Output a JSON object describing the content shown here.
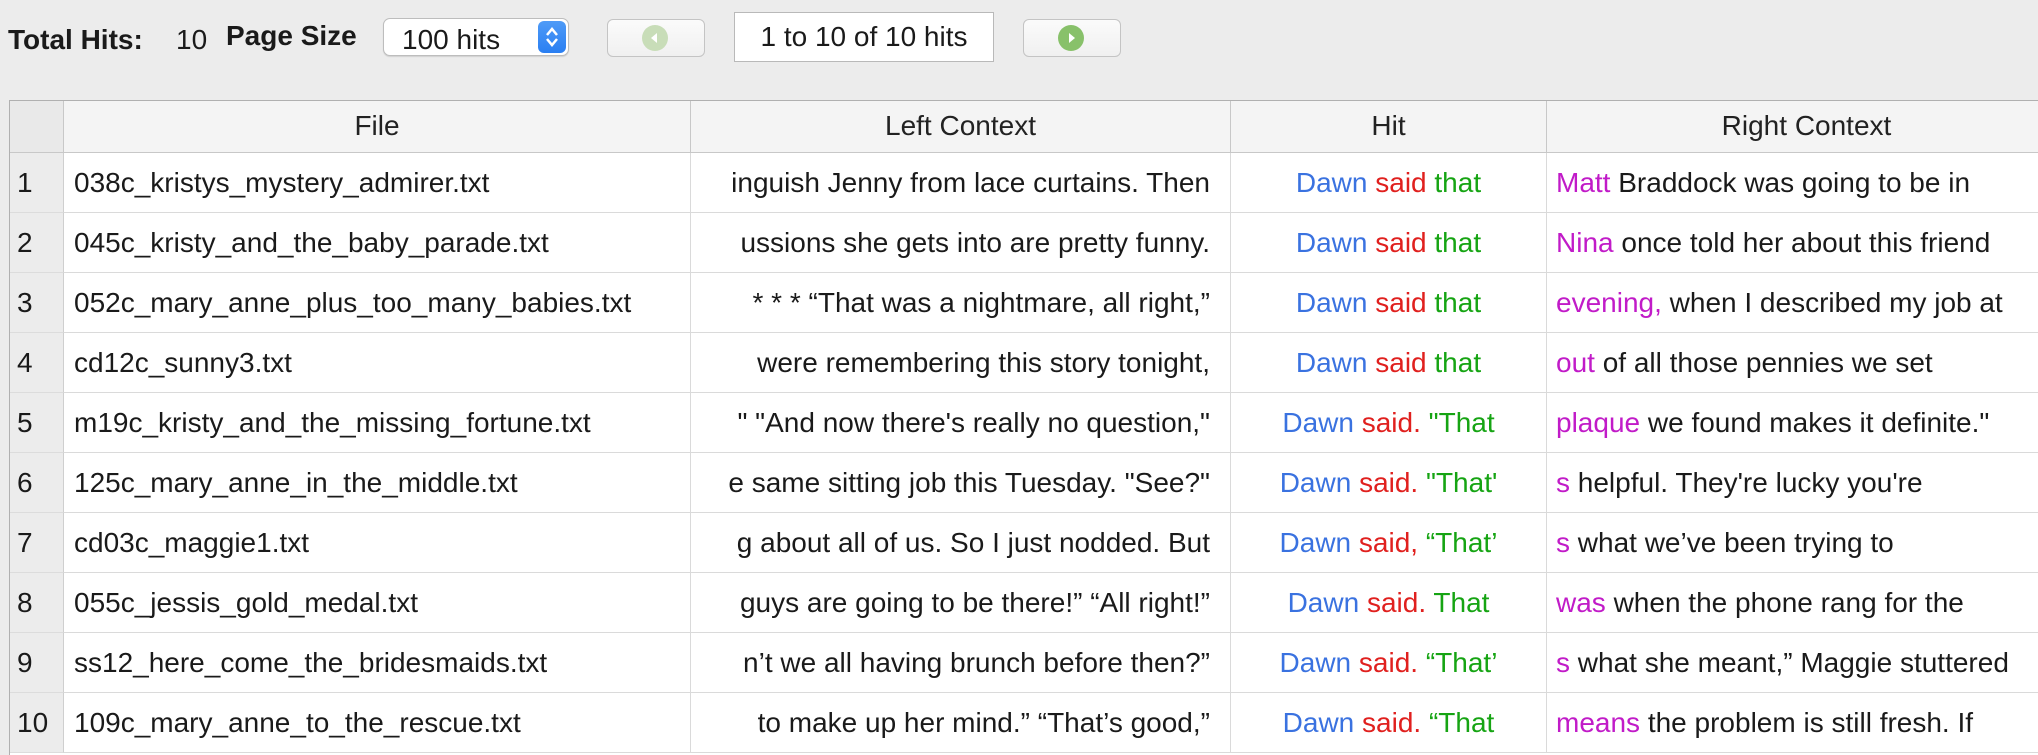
{
  "toolbar": {
    "total_hits_label": "Total Hits:",
    "total_hits_value": "10",
    "page_size_label": "Page Size",
    "page_size_value": "100 hits",
    "range_text": "1 to 10 of 10 hits",
    "prev_icon": "back-arrow-icon",
    "next_icon": "forward-arrow-icon"
  },
  "table": {
    "columns": [
      "File",
      "Left Context",
      "Hit",
      "Right Context"
    ],
    "rows": [
      {
        "num": "1",
        "file": "038c_kristys_mystery_admirer.txt",
        "left": "inguish Jenny from lace curtains. Then",
        "hit": [
          "Dawn",
          "said",
          "that"
        ],
        "right_first": "Matt",
        "right_rest": " Braddock was going to be in"
      },
      {
        "num": "2",
        "file": "045c_kristy_and_the_baby_parade.txt",
        "left": "ussions she gets into are pretty funny.",
        "hit": [
          "Dawn",
          "said",
          "that"
        ],
        "right_first": "Nina",
        "right_rest": " once told her about this friend"
      },
      {
        "num": "3",
        "file": "052c_mary_anne_plus_too_many_babies.txt",
        "left": "* * * “That was a nightmare, all right,”",
        "hit": [
          "Dawn",
          "said",
          "that"
        ],
        "right_first": "evening,",
        "right_rest": " when I described my job at"
      },
      {
        "num": "4",
        "file": "cd12c_sunny3.txt",
        "left": "were remembering this story tonight,",
        "hit": [
          "Dawn",
          "said",
          "that"
        ],
        "right_first": "out",
        "right_rest": " of all those pennies we set"
      },
      {
        "num": "5",
        "file": "m19c_kristy_and_the_missing_fortune.txt",
        "left": "\" \"And now there's really no question,\"",
        "hit": [
          "Dawn",
          "said.",
          "\"That"
        ],
        "right_first": "plaque",
        "right_rest": " we found makes it definite.\""
      },
      {
        "num": "6",
        "file": "125c_mary_anne_in_the_middle.txt",
        "left": "e same sitting job this Tuesday. \"See?\"",
        "hit": [
          "Dawn",
          "said.",
          "\"That'"
        ],
        "right_first": "s",
        "right_rest": " helpful. They're lucky you're"
      },
      {
        "num": "7",
        "file": "cd03c_maggie1.txt",
        "left": "g about all of us. So I just nodded. But",
        "hit": [
          "Dawn",
          "said,",
          "“That’"
        ],
        "right_first": "s",
        "right_rest": " what we’ve been trying to"
      },
      {
        "num": "8",
        "file": "055c_jessis_gold_medal.txt",
        "left": "guys are going to be there!” “All right!”",
        "hit": [
          "Dawn",
          "said.",
          "That"
        ],
        "right_first": "was",
        "right_rest": " when the phone rang for the"
      },
      {
        "num": "9",
        "file": "ss12_here_come_the_bridesmaids.txt",
        "left": "n’t we all having brunch before then?”",
        "hit": [
          "Dawn",
          "said.",
          "“That’"
        ],
        "right_first": "s",
        "right_rest": " what she meant,” Maggie stuttered"
      },
      {
        "num": "10",
        "file": "109c_mary_anne_to_the_rescue.txt",
        "left": "to make up her mind.” “That’s good,”",
        "hit": [
          "Dawn",
          "said.",
          "“That"
        ],
        "right_first": "means",
        "right_rest": " the problem is still fresh. If"
      }
    ]
  }
}
